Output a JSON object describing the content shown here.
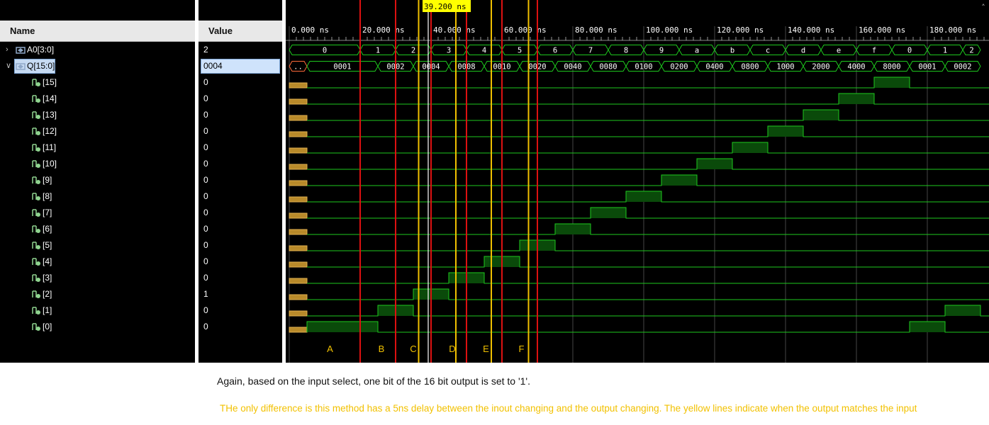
{
  "columns": {
    "name": "Name",
    "value": "Value"
  },
  "signals": [
    {
      "name": "A0[3:0]",
      "value": "2",
      "kind": "bus",
      "expanded": false
    },
    {
      "name": "Q[15:0]",
      "value": "0004",
      "kind": "bus",
      "expanded": true,
      "selected": true
    },
    {
      "name": "[15]",
      "value": "0",
      "kind": "bit"
    },
    {
      "name": "[14]",
      "value": "0",
      "kind": "bit"
    },
    {
      "name": "[13]",
      "value": "0",
      "kind": "bit"
    },
    {
      "name": "[12]",
      "value": "0",
      "kind": "bit"
    },
    {
      "name": "[11]",
      "value": "0",
      "kind": "bit"
    },
    {
      "name": "[10]",
      "value": "0",
      "kind": "bit"
    },
    {
      "name": "[9]",
      "value": "0",
      "kind": "bit"
    },
    {
      "name": "[8]",
      "value": "0",
      "kind": "bit"
    },
    {
      "name": "[7]",
      "value": "0",
      "kind": "bit"
    },
    {
      "name": "[6]",
      "value": "0",
      "kind": "bit"
    },
    {
      "name": "[5]",
      "value": "0",
      "kind": "bit"
    },
    {
      "name": "[4]",
      "value": "0",
      "kind": "bit"
    },
    {
      "name": "[3]",
      "value": "0",
      "kind": "bit"
    },
    {
      "name": "[2]",
      "value": "1",
      "kind": "bit"
    },
    {
      "name": "[1]",
      "value": "0",
      "kind": "bit"
    },
    {
      "name": "[0]",
      "value": "0",
      "kind": "bit"
    }
  ],
  "cursor": "39.200 ns",
  "time_ticks": [
    "0.000 ns",
    "20.000 ns",
    "40.000 ns",
    "60.000 ns",
    "80.000 ns",
    "100.000 ns",
    "120.000 ns",
    "140.000 ns",
    "160.000 ns",
    "180.000 ns"
  ],
  "time_range_ns": [
    0,
    195
  ],
  "a0_bus": {
    "times_ns": [
      0,
      20,
      30,
      40,
      50,
      60,
      70,
      80,
      90,
      100,
      110,
      120,
      130,
      140,
      150,
      160,
      170,
      180,
      190
    ],
    "values": [
      "0",
      "1",
      "2",
      "3",
      "4",
      "5",
      "6",
      "7",
      "8",
      "9",
      "a",
      "b",
      "c",
      "d",
      "e",
      "f",
      "0",
      "1",
      "2"
    ]
  },
  "q_bus": {
    "times_ns": [
      0,
      5,
      25,
      35,
      45,
      55,
      65,
      75,
      85,
      95,
      105,
      115,
      125,
      135,
      145,
      155,
      165,
      175,
      185
    ],
    "values": [
      "..",
      "0001",
      "0002",
      "0004",
      "0008",
      "0010",
      "0020",
      "0040",
      "0080",
      "0100",
      "0200",
      "0400",
      "0800",
      "1000",
      "2000",
      "4000",
      "8000",
      "0001",
      "0002"
    ]
  },
  "bit_high_intervals_ns": {
    "15": [
      [
        165,
        175
      ]
    ],
    "14": [
      [
        155,
        165
      ]
    ],
    "13": [
      [
        145,
        155
      ]
    ],
    "12": [
      [
        135,
        145
      ]
    ],
    "11": [
      [
        125,
        135
      ]
    ],
    "10": [
      [
        115,
        125
      ]
    ],
    "9": [
      [
        105,
        115
      ]
    ],
    "8": [
      [
        95,
        105
      ]
    ],
    "7": [
      [
        85,
        95
      ]
    ],
    "6": [
      [
        75,
        85
      ]
    ],
    "5": [
      [
        65,
        75
      ]
    ],
    "4": [
      [
        55,
        65
      ]
    ],
    "3": [
      [
        45,
        55
      ]
    ],
    "2": [
      [
        35,
        45
      ]
    ],
    "1": [
      [
        25,
        35
      ],
      [
        185,
        195
      ]
    ],
    "0": [
      [
        5,
        25
      ],
      [
        175,
        185
      ]
    ]
  },
  "red_markers_ns": [
    20,
    30,
    40,
    50,
    60,
    70
  ],
  "yellow_markers_ns": [
    36.5,
    47,
    57,
    67.5
  ],
  "annotations": [
    {
      "label": "A",
      "time_ns": 11.5
    },
    {
      "label": "B",
      "time_ns": 26
    },
    {
      "label": "C",
      "time_ns": 35
    },
    {
      "label": "D",
      "time_ns": 46
    },
    {
      "label": "E",
      "time_ns": 55.5
    },
    {
      "label": "F",
      "time_ns": 65.5
    }
  ],
  "colors": {
    "wave_green": "#1ec81e",
    "high_fill": "#0a4a0a",
    "bus_text": "#ffffff",
    "red_marker": "#dd1111",
    "yellow_marker": "#f0c000",
    "cursor_bg": "#ffff00",
    "grid": "#8a8a8a",
    "annotation": "#f0c000"
  },
  "caption": "Again, based on the input select, one bit of the 16 bit output is set to '1'.",
  "note": "THe only difference is this method has a 5ns delay between the inout changing and the output changing. The yellow lines indicate when the output matches the input"
}
